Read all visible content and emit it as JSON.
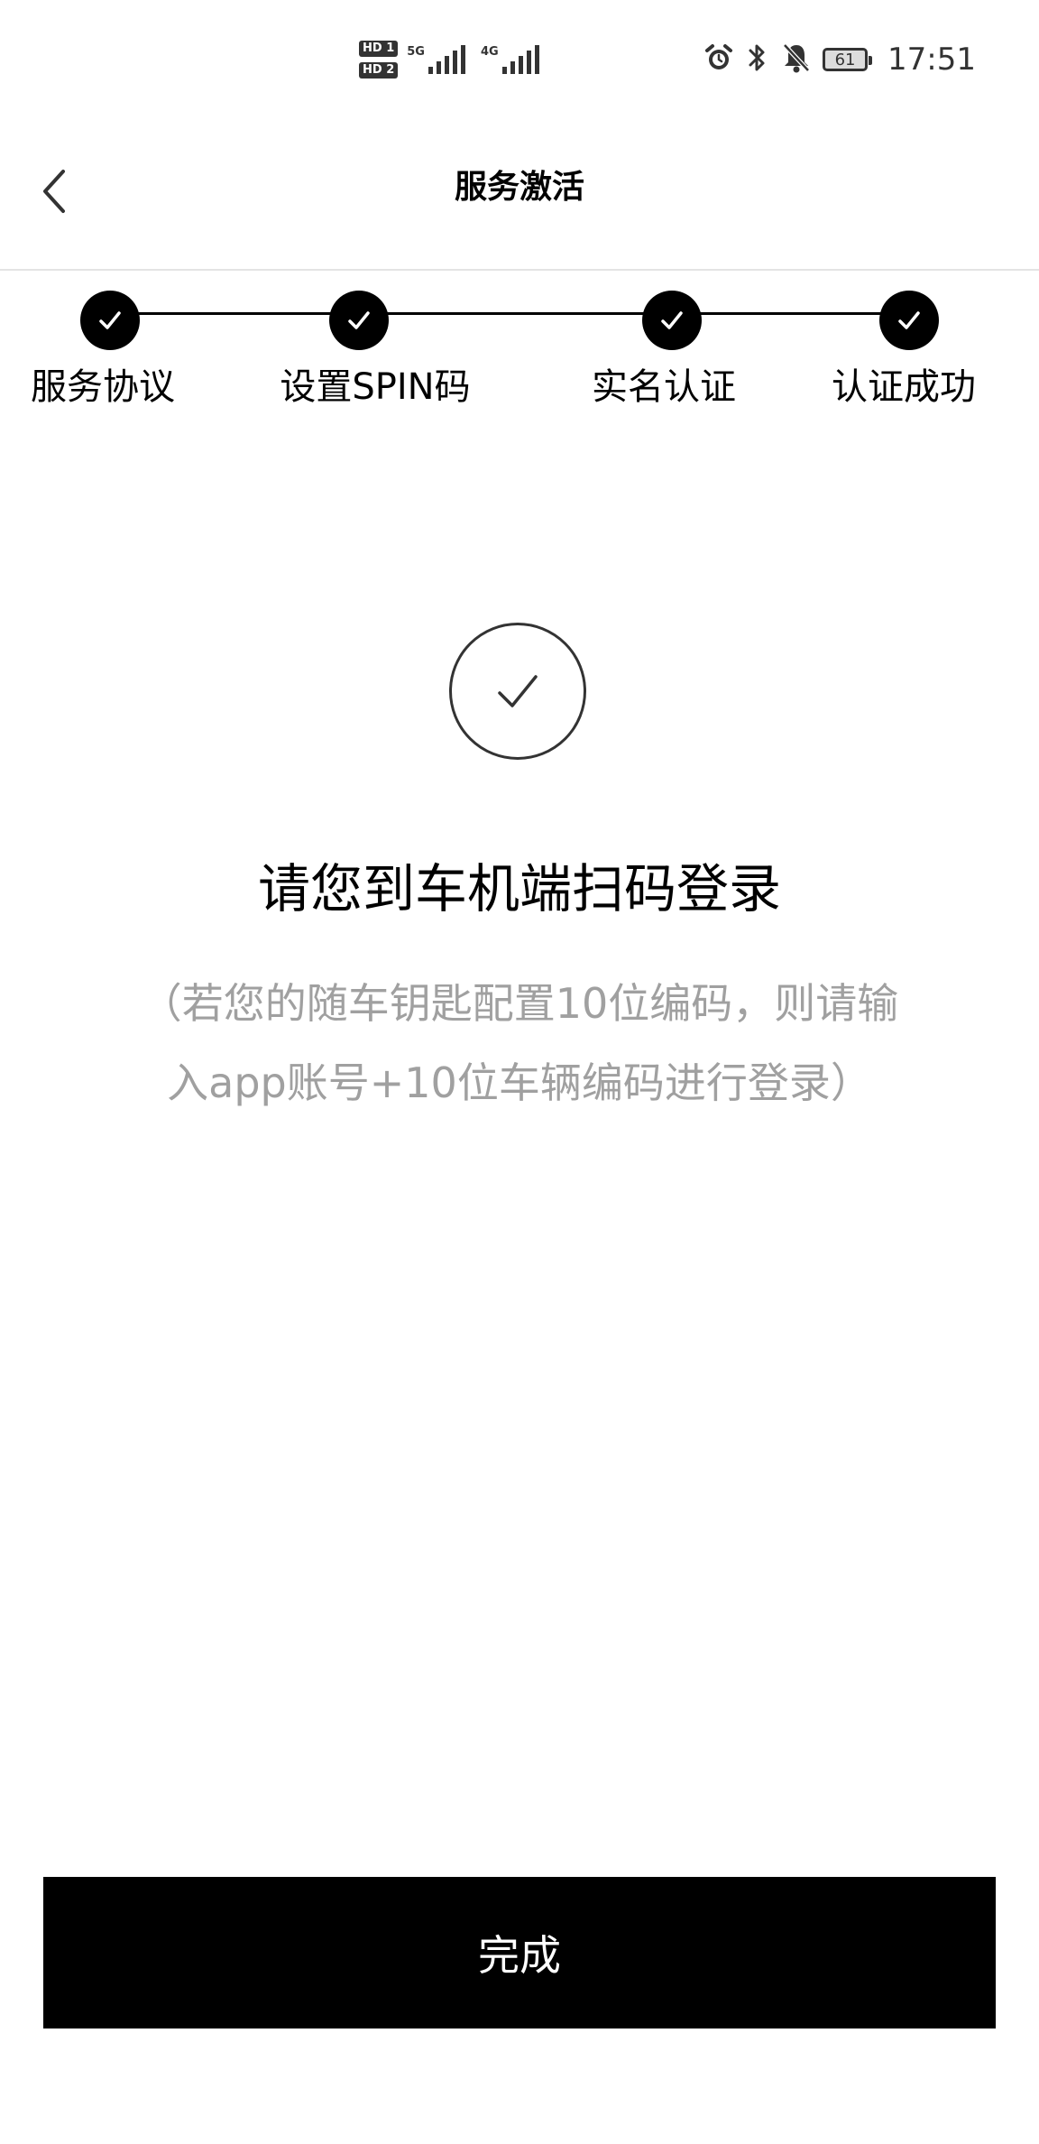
{
  "status_bar": {
    "hd1": "HD 1",
    "hd2": "HD 2",
    "net1": "5G",
    "net2": "4G",
    "battery": "61",
    "time": "17:51",
    "icons": [
      "alarm-icon",
      "bluetooth-icon",
      "mute-bell-icon",
      "battery-icon"
    ]
  },
  "header": {
    "title": "服务激活",
    "back_icon": "chevron-left-icon"
  },
  "stepper": {
    "steps": [
      {
        "label": "服务协议",
        "completed": true
      },
      {
        "label": "设置SPIN码",
        "completed": true
      },
      {
        "label": "实名认证",
        "completed": true
      },
      {
        "label": "认证成功",
        "completed": true
      }
    ]
  },
  "content": {
    "icon": "check-circle-icon",
    "message": "请您到车机端扫码登录",
    "note_line1": "（若您的随车钥匙配置10位编码，则请输",
    "note_line2": "入app账号+10位车辆编码进行登录）"
  },
  "footer": {
    "done_label": "完成"
  },
  "colors": {
    "primary": "#000000",
    "note_text": "#a0a0a0",
    "background": "#ffffff"
  }
}
